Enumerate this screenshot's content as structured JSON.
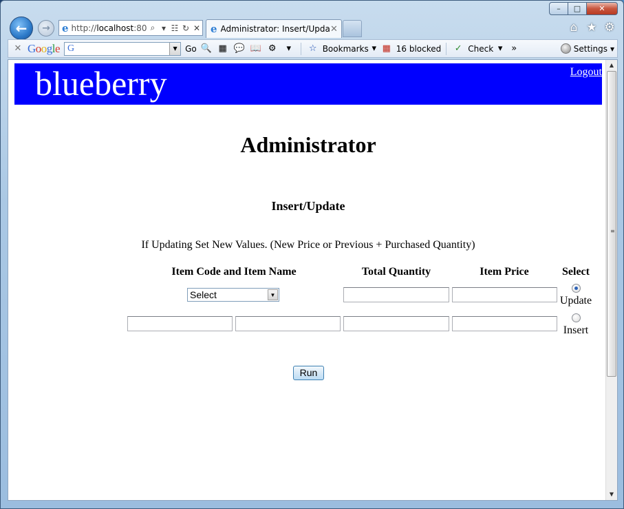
{
  "window": {
    "minimize": "–",
    "maximize": "□",
    "close": "✕"
  },
  "browser": {
    "address": {
      "url_prefix": "http://",
      "url_host": "localhost",
      "url_suffix": ":80",
      "search_glyph": "⌕",
      "dropdown_glyph": "▾",
      "compat_glyph": "☷",
      "refresh_glyph": "↻",
      "stop_glyph": "✕"
    },
    "tab": {
      "title": "Administrator: Insert/Update",
      "close": "✕"
    },
    "icons": {
      "home": "⌂",
      "favorites": "★",
      "tools": "⚙"
    }
  },
  "toolbar": {
    "close": "✕",
    "google_logo": [
      "G",
      "o",
      "o",
      "g",
      "l",
      "e"
    ],
    "search_g": "G",
    "go_label": "Go",
    "bookmarks_label": "Bookmarks",
    "blocked_label": "16 blocked",
    "check_label": "Check",
    "more_glyph": "»",
    "settings_label": "Settings"
  },
  "page": {
    "brand": "blueberry",
    "logout": "Logout",
    "title": "Administrator",
    "section": "Insert/Update",
    "instruction": "If Updating Set New Values. (New Price or Previous + Purchased Quantity)",
    "columns": {
      "item": "Item Code and Item Name",
      "quantity": "Total Quantity",
      "price": "Item Price",
      "select": "Select"
    },
    "update_row": {
      "select_value": "Select",
      "quantity": "",
      "price": "",
      "radio_label": "Update",
      "checked": true
    },
    "insert_row": {
      "item_code": "",
      "item_name": "",
      "quantity": "",
      "price": "",
      "radio_label": "Insert",
      "checked": false
    },
    "run_label": "Run"
  },
  "colors": {
    "banner": "#0000ff",
    "text": "#000000"
  }
}
